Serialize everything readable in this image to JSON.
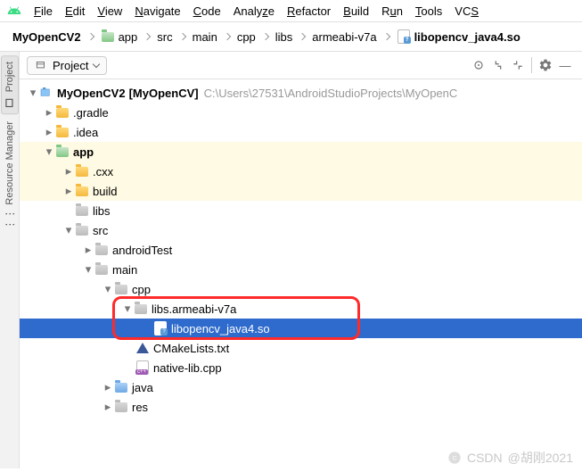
{
  "menu": {
    "items": [
      "File",
      "Edit",
      "View",
      "Navigate",
      "Code",
      "Analyze",
      "Refactor",
      "Build",
      "Run",
      "Tools",
      "VCS"
    ]
  },
  "breadcrumb": {
    "items": [
      "MyOpenCV2",
      "app",
      "src",
      "main",
      "cpp",
      "libs",
      "armeabi-v7a",
      "libopencv_java4.so"
    ]
  },
  "sideTabs": {
    "project": "Project",
    "resman": "Resource Manager"
  },
  "projectPanel": {
    "selectorLabel": "Project",
    "tree": {
      "root": {
        "name": "MyOpenCV2",
        "bold": "[MyOpenCV]",
        "hint": "C:\\Users\\27531\\AndroidStudioProjects\\MyOpenC"
      },
      "gradle": ".gradle",
      "idea": ".idea",
      "app": "app",
      "cxx": ".cxx",
      "build": "build",
      "libs": "libs",
      "src": "src",
      "androidTest": "androidTest",
      "main": "main",
      "cpp": "cpp",
      "libsarm": "libs.armeabi-v7a",
      "libopencv": "libopencv_java4.so",
      "cmake": "CMakeLists.txt",
      "nativelib": "native-lib.cpp",
      "java": "java",
      "res": "res"
    }
  },
  "watermark": {
    "prefix": "CSDN",
    "author": "@胡刚2021"
  }
}
